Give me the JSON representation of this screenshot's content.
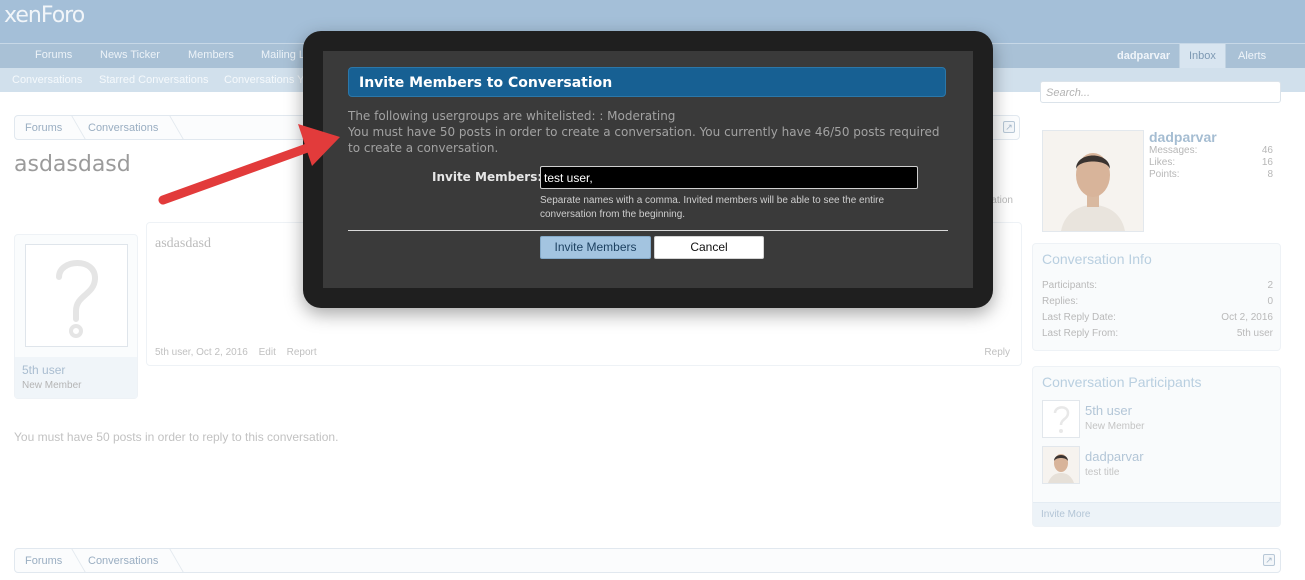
{
  "header": {
    "logo": "xenForo",
    "nav_tabs": [
      "Forums",
      "News Ticker",
      "Members",
      "Mailing Lists"
    ],
    "user": "dadparvar",
    "inbox": "Inbox",
    "alerts": "Alerts"
  },
  "subnav": {
    "items": [
      "Conversations",
      "Starred Conversations",
      "Conversations You Started"
    ]
  },
  "breadcrumb": {
    "items": [
      "Forums",
      "Conversations"
    ]
  },
  "page": {
    "title": "asdasdasd",
    "leave_link": "Leave Conversation",
    "reply_notice": "You must have 50 posts in order to reply to this conversation."
  },
  "post": {
    "author": "5th user",
    "author_title": "New Member",
    "text": "asdasdasd",
    "meta_author_date": "5th user, Oct 2, 2016",
    "edit": "Edit",
    "report": "Report",
    "reply": "Reply"
  },
  "sidebar": {
    "search_placeholder": "Search...",
    "visitor": {
      "name": "dadparvar",
      "stats": [
        {
          "label": "Messages:",
          "value": "46"
        },
        {
          "label": "Likes:",
          "value": "16"
        },
        {
          "label": "Points:",
          "value": "8"
        }
      ]
    },
    "info": {
      "heading": "Conversation Info",
      "rows": [
        {
          "label": "Participants:",
          "value": "2"
        },
        {
          "label": "Replies:",
          "value": "0"
        },
        {
          "label": "Last Reply Date:",
          "value": "Oct 2, 2016"
        },
        {
          "label": "Last Reply From:",
          "value": "5th user"
        }
      ]
    },
    "participants": {
      "heading": "Conversation Participants",
      "list": [
        {
          "name": "5th user",
          "title": "New Member"
        },
        {
          "name": "dadparvar",
          "title": "test title"
        }
      ],
      "invite_more": "Invite More"
    }
  },
  "modal": {
    "title": "Invite Members to Conversation",
    "line1": "The following usergroups are whitelisted: : Moderating",
    "line2": "You must have 50 posts in order to create a conversation. You currently have 46/50 posts required to create a conversation.",
    "invite_label": "Invite Members:",
    "invite_value": "test user,",
    "hint": "Separate names with a comma. Invited members will be able to see the entire conversation from the beginning.",
    "submit": "Invite Members",
    "cancel": "Cancel"
  },
  "colors": {
    "header_bg": "#a4bfd8",
    "modal_head": "#176093",
    "arrow": "#e23b3b"
  }
}
